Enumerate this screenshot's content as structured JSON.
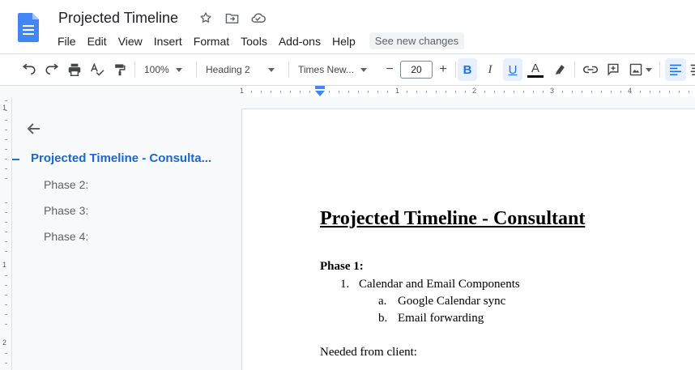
{
  "app": {
    "title": "Projected Timeline",
    "menu": [
      "File",
      "Edit",
      "View",
      "Insert",
      "Format",
      "Tools",
      "Add-ons",
      "Help"
    ],
    "see_changes": "See new changes"
  },
  "toolbar": {
    "zoom": "100%",
    "style": "Heading 2",
    "font": "Times New...",
    "font_size": "20",
    "minus": "−",
    "plus": "+",
    "bold": "B",
    "italic": "I",
    "underline": "U",
    "text_color": "A",
    "accent": "#1a73e8"
  },
  "ruler": {
    "h_numbers": [
      "1",
      "1",
      "2",
      "3",
      "4"
    ],
    "v_numbers": [
      "1",
      "1",
      "2"
    ]
  },
  "outline": {
    "title": "Projected Timeline - Consulta...",
    "items": [
      "Phase 2:",
      "Phase 3:",
      "Phase 4:"
    ]
  },
  "document": {
    "heading": "Projected Timeline - Consultant",
    "phase1": "Phase 1:",
    "list": {
      "n1": "1.",
      "item1": "Calendar and Email Components",
      "na": "a.",
      "sub_a": "Google Calendar sync",
      "nb": "b.",
      "sub_b": "Email forwarding"
    },
    "needed": "Needed from client:"
  }
}
